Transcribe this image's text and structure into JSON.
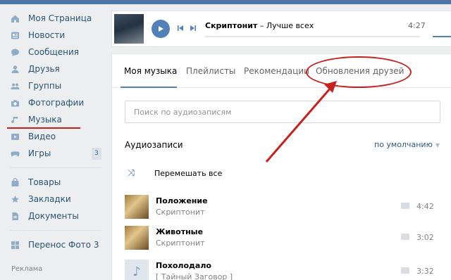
{
  "sidebar": {
    "items": [
      {
        "label": "Моя Страница",
        "icon": "home-icon"
      },
      {
        "label": "Новости",
        "icon": "news-icon"
      },
      {
        "label": "Сообщения",
        "icon": "messages-icon"
      },
      {
        "label": "Друзья",
        "icon": "friends-icon"
      },
      {
        "label": "Группы",
        "icon": "groups-icon"
      },
      {
        "label": "Фотографии",
        "icon": "camera-icon"
      },
      {
        "label": "Музыка",
        "icon": "music-icon"
      },
      {
        "label": "Видео",
        "icon": "video-icon"
      },
      {
        "label": "Игры",
        "icon": "games-icon",
        "count": "3"
      },
      {
        "label": "Товары",
        "icon": "bag-icon"
      },
      {
        "label": "Закладки",
        "icon": "star-icon"
      },
      {
        "label": "Документы",
        "icon": "document-icon"
      },
      {
        "label": "Перенос Фото 3",
        "icon": "app-icon"
      }
    ],
    "ads_label": "Реклама"
  },
  "player": {
    "artist": "Скриптонит",
    "separator": " – ",
    "song": "Лучше всех",
    "time": "4:27"
  },
  "tabs": [
    "Моя музыка",
    "Плейлисты",
    "Рекомендации",
    "Обновления друзей"
  ],
  "search": {
    "placeholder": "Поиск по аудиозаписям"
  },
  "list": {
    "title": "Аудиозаписи",
    "sort_label": "по умолчанию",
    "shuffle_label": "Перемешать все",
    "tracks": [
      {
        "title": "Положение",
        "artist": "Скриптонит",
        "duration": "4:42"
      },
      {
        "title": "Животные",
        "artist": "Скриптонит",
        "duration": "3:02"
      },
      {
        "title": "Похолодало",
        "artist": "[ Тайный Заговор ]",
        "duration": "3:32"
      }
    ]
  },
  "colors": {
    "accent": "#5181b8",
    "annotation": "#c5221f",
    "link": "#2a5885"
  }
}
